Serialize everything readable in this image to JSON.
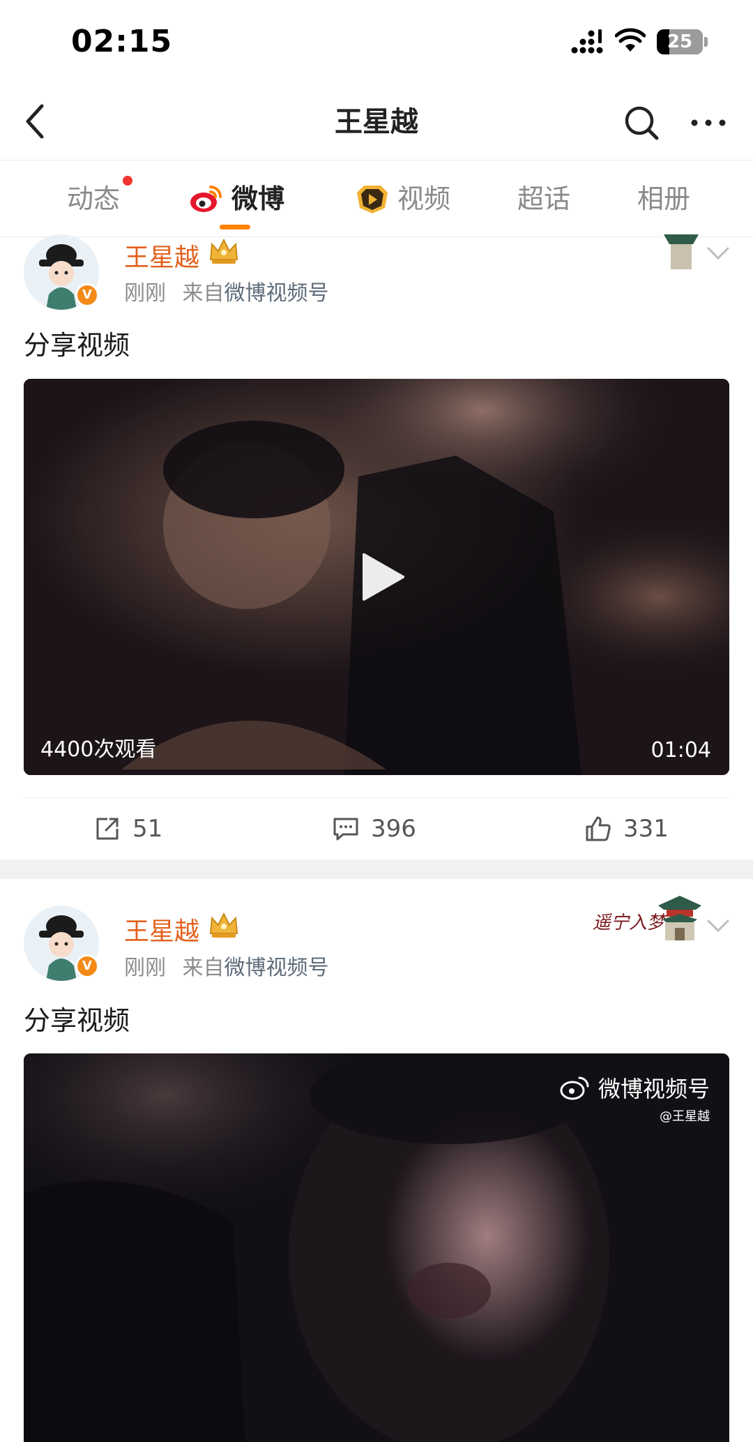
{
  "status_bar": {
    "time": "02:15",
    "battery": "25"
  },
  "nav": {
    "title": "王星越"
  },
  "tabs": [
    {
      "label": "动态",
      "has_dot": true
    },
    {
      "label": "微博",
      "active": true
    },
    {
      "label": "视频"
    },
    {
      "label": "超话"
    },
    {
      "label": "相册"
    }
  ],
  "posts": [
    {
      "author": "王星越",
      "time": "刚刚",
      "source_prefix": "来自",
      "source": "微博视频号",
      "text": "分享视频",
      "video": {
        "views": "4400次观看",
        "duration": "01:04"
      },
      "actions": {
        "repost": "51",
        "comment": "396",
        "like": "331"
      }
    },
    {
      "author": "王星越",
      "time": "刚刚",
      "source_prefix": "来自",
      "source": "微博视频号",
      "text": "分享视频",
      "video": {
        "watermark_brand": "微博视频号",
        "watermark_handle": "@王星越"
      }
    }
  ],
  "decoration_text": "遥宁入梦",
  "colors": {
    "accent_orange": "#ff8200",
    "author_name": "#e2611d",
    "dot_red": "#f0352f"
  }
}
